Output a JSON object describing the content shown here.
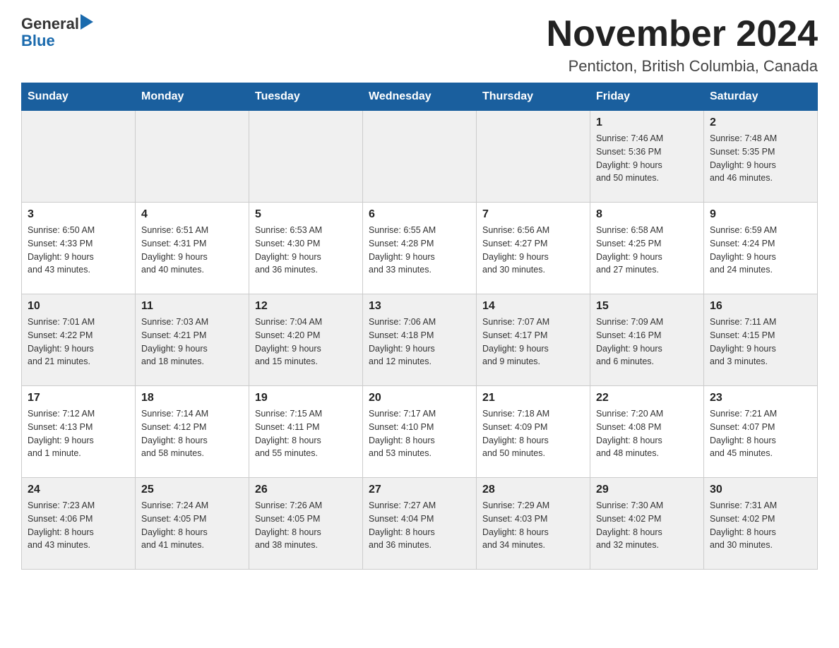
{
  "header": {
    "logo_general": "General",
    "logo_blue": "Blue",
    "main_title": "November 2024",
    "subtitle": "Penticton, British Columbia, Canada"
  },
  "days_of_week": [
    "Sunday",
    "Monday",
    "Tuesday",
    "Wednesday",
    "Thursday",
    "Friday",
    "Saturday"
  ],
  "weeks": [
    {
      "days": [
        {
          "number": "",
          "info": ""
        },
        {
          "number": "",
          "info": ""
        },
        {
          "number": "",
          "info": ""
        },
        {
          "number": "",
          "info": ""
        },
        {
          "number": "",
          "info": ""
        },
        {
          "number": "1",
          "info": "Sunrise: 7:46 AM\nSunset: 5:36 PM\nDaylight: 9 hours\nand 50 minutes."
        },
        {
          "number": "2",
          "info": "Sunrise: 7:48 AM\nSunset: 5:35 PM\nDaylight: 9 hours\nand 46 minutes."
        }
      ]
    },
    {
      "days": [
        {
          "number": "3",
          "info": "Sunrise: 6:50 AM\nSunset: 4:33 PM\nDaylight: 9 hours\nand 43 minutes."
        },
        {
          "number": "4",
          "info": "Sunrise: 6:51 AM\nSunset: 4:31 PM\nDaylight: 9 hours\nand 40 minutes."
        },
        {
          "number": "5",
          "info": "Sunrise: 6:53 AM\nSunset: 4:30 PM\nDaylight: 9 hours\nand 36 minutes."
        },
        {
          "number": "6",
          "info": "Sunrise: 6:55 AM\nSunset: 4:28 PM\nDaylight: 9 hours\nand 33 minutes."
        },
        {
          "number": "7",
          "info": "Sunrise: 6:56 AM\nSunset: 4:27 PM\nDaylight: 9 hours\nand 30 minutes."
        },
        {
          "number": "8",
          "info": "Sunrise: 6:58 AM\nSunset: 4:25 PM\nDaylight: 9 hours\nand 27 minutes."
        },
        {
          "number": "9",
          "info": "Sunrise: 6:59 AM\nSunset: 4:24 PM\nDaylight: 9 hours\nand 24 minutes."
        }
      ]
    },
    {
      "days": [
        {
          "number": "10",
          "info": "Sunrise: 7:01 AM\nSunset: 4:22 PM\nDaylight: 9 hours\nand 21 minutes."
        },
        {
          "number": "11",
          "info": "Sunrise: 7:03 AM\nSunset: 4:21 PM\nDaylight: 9 hours\nand 18 minutes."
        },
        {
          "number": "12",
          "info": "Sunrise: 7:04 AM\nSunset: 4:20 PM\nDaylight: 9 hours\nand 15 minutes."
        },
        {
          "number": "13",
          "info": "Sunrise: 7:06 AM\nSunset: 4:18 PM\nDaylight: 9 hours\nand 12 minutes."
        },
        {
          "number": "14",
          "info": "Sunrise: 7:07 AM\nSunset: 4:17 PM\nDaylight: 9 hours\nand 9 minutes."
        },
        {
          "number": "15",
          "info": "Sunrise: 7:09 AM\nSunset: 4:16 PM\nDaylight: 9 hours\nand 6 minutes."
        },
        {
          "number": "16",
          "info": "Sunrise: 7:11 AM\nSunset: 4:15 PM\nDaylight: 9 hours\nand 3 minutes."
        }
      ]
    },
    {
      "days": [
        {
          "number": "17",
          "info": "Sunrise: 7:12 AM\nSunset: 4:13 PM\nDaylight: 9 hours\nand 1 minute."
        },
        {
          "number": "18",
          "info": "Sunrise: 7:14 AM\nSunset: 4:12 PM\nDaylight: 8 hours\nand 58 minutes."
        },
        {
          "number": "19",
          "info": "Sunrise: 7:15 AM\nSunset: 4:11 PM\nDaylight: 8 hours\nand 55 minutes."
        },
        {
          "number": "20",
          "info": "Sunrise: 7:17 AM\nSunset: 4:10 PM\nDaylight: 8 hours\nand 53 minutes."
        },
        {
          "number": "21",
          "info": "Sunrise: 7:18 AM\nSunset: 4:09 PM\nDaylight: 8 hours\nand 50 minutes."
        },
        {
          "number": "22",
          "info": "Sunrise: 7:20 AM\nSunset: 4:08 PM\nDaylight: 8 hours\nand 48 minutes."
        },
        {
          "number": "23",
          "info": "Sunrise: 7:21 AM\nSunset: 4:07 PM\nDaylight: 8 hours\nand 45 minutes."
        }
      ]
    },
    {
      "days": [
        {
          "number": "24",
          "info": "Sunrise: 7:23 AM\nSunset: 4:06 PM\nDaylight: 8 hours\nand 43 minutes."
        },
        {
          "number": "25",
          "info": "Sunrise: 7:24 AM\nSunset: 4:05 PM\nDaylight: 8 hours\nand 41 minutes."
        },
        {
          "number": "26",
          "info": "Sunrise: 7:26 AM\nSunset: 4:05 PM\nDaylight: 8 hours\nand 38 minutes."
        },
        {
          "number": "27",
          "info": "Sunrise: 7:27 AM\nSunset: 4:04 PM\nDaylight: 8 hours\nand 36 minutes."
        },
        {
          "number": "28",
          "info": "Sunrise: 7:29 AM\nSunset: 4:03 PM\nDaylight: 8 hours\nand 34 minutes."
        },
        {
          "number": "29",
          "info": "Sunrise: 7:30 AM\nSunset: 4:02 PM\nDaylight: 8 hours\nand 32 minutes."
        },
        {
          "number": "30",
          "info": "Sunrise: 7:31 AM\nSunset: 4:02 PM\nDaylight: 8 hours\nand 30 minutes."
        }
      ]
    }
  ]
}
